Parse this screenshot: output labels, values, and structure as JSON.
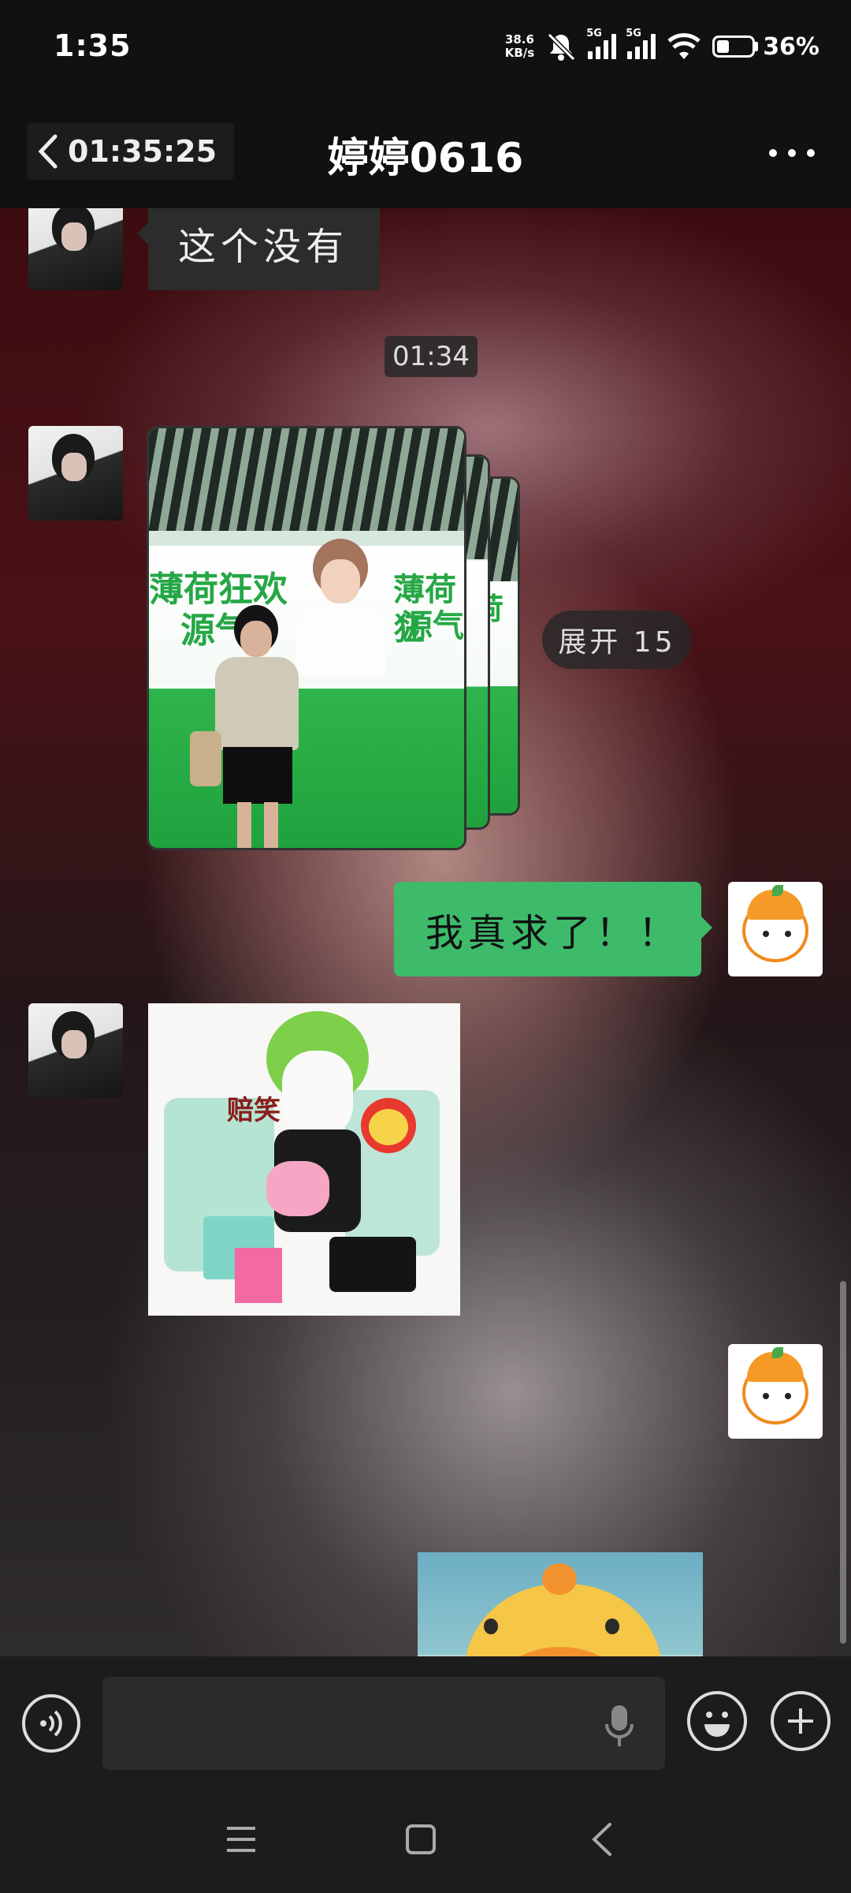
{
  "status_bar": {
    "time": "1:35",
    "net_speed_value": "38.6",
    "net_speed_unit": "KB/s",
    "signal_1_label": "5G",
    "signal_2_label": "5G",
    "battery_percent": "36%",
    "battery_level": 0.36,
    "icons": [
      "mute-bell-icon",
      "signal-5g-icon",
      "signal-5g-icon",
      "wifi-icon",
      "battery-icon"
    ]
  },
  "header": {
    "back_time": "01:35:25",
    "title": "婷婷0616",
    "more_icon": "more-dots-icon"
  },
  "messages": [
    {
      "side": "left",
      "type": "text",
      "text": "这个没有"
    },
    {
      "side": "center",
      "type": "time",
      "text": "01:34"
    },
    {
      "side": "left",
      "type": "photo-stack",
      "expand_label": "展开 15",
      "poster_text_1": "薄荷狂欢",
      "poster_text_2": "源气",
      "poster_text_3": "薄荷狂",
      "poster_text_4": "源气"
    },
    {
      "side": "right",
      "type": "text",
      "text": "我真求了！！"
    },
    {
      "side": "left",
      "type": "sticker",
      "caption": "赔笑"
    },
    {
      "side": "right",
      "type": "sticker",
      "caption": ""
    }
  ],
  "input_bar": {
    "voice_icon": "voice-mode-icon",
    "input_value": "",
    "mic_icon": "microphone-icon",
    "emoji_icon": "emoji-icon",
    "plus_icon": "plus-icon"
  },
  "nav_bar": {
    "icons": [
      "menu-icon",
      "home-square-icon",
      "back-chevron-icon"
    ]
  },
  "colors": {
    "sent_bubble": "#3dba6a",
    "received_bubble": "#2c2c2c",
    "bar_background": "#1c1c1c"
  }
}
